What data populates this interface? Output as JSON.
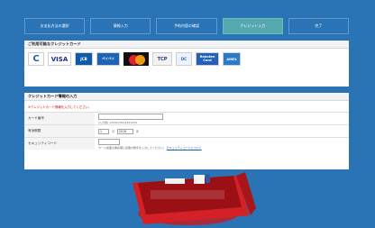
{
  "steps": [
    {
      "label": "お支払方法の選択",
      "active": false
    },
    {
      "label": "情報入力",
      "active": false
    },
    {
      "label": "予約内容の確認",
      "active": false
    },
    {
      "label": "クレジット入力",
      "active": true
    },
    {
      "label": "完了",
      "active": false
    }
  ],
  "cards_section": {
    "title": "ご利用可能なクレジットカード",
    "logos": [
      {
        "name": "c-icon",
        "text": "C"
      },
      {
        "name": "visa-icon",
        "text": "VISA"
      },
      {
        "name": "jcb-icon",
        "text": "JCB"
      },
      {
        "name": "pay-icon",
        "text": "ペイペイ"
      },
      {
        "name": "mastercard-icon",
        "text": ""
      },
      {
        "name": "tcp-icon",
        "text": "TCP"
      },
      {
        "name": "dc-icon",
        "text": "DC"
      },
      {
        "name": "rakuten-icon",
        "text": "Rakuten Card"
      },
      {
        "name": "amex-icon",
        "text": "AMEX"
      }
    ]
  },
  "form_section": {
    "title": "クレジットカード情報の入力",
    "note": "※クレジットカード情報を入力してください。",
    "card_number": {
      "label": "カード番号",
      "placeholder": "",
      "hint": "(入力例)  1234123412341234"
    },
    "expiry": {
      "label": "有効期限",
      "month": "1",
      "month_unit": "月",
      "year": "2019",
      "year_unit": "年"
    },
    "security": {
      "label": "セキュリティコード",
      "hint": "カード裏面の署名欄に記載の数字を入力してください。",
      "link": "セキュリティコードについて"
    }
  }
}
